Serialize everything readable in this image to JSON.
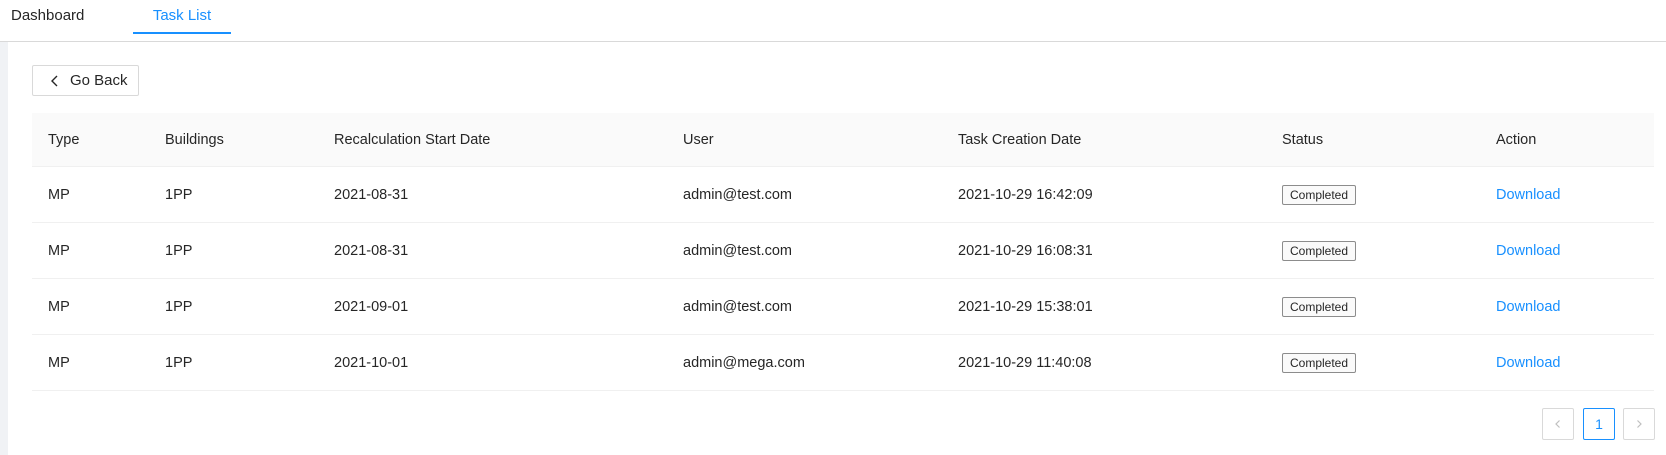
{
  "tabs": [
    {
      "label": "Dashboard",
      "active": false
    },
    {
      "label": "Task List",
      "active": true
    }
  ],
  "back_button": {
    "label": "Go Back"
  },
  "table": {
    "columns": [
      "Type",
      "Buildings",
      "Recalculation Start Date",
      "User",
      "Task Creation Date",
      "Status",
      "Action"
    ],
    "rows": [
      [
        "MP",
        "1PP",
        "2021-08-31",
        "admin@test.com",
        "2021-10-29 16:42:09",
        "Completed",
        "Download"
      ],
      [
        "MP",
        "1PP",
        "2021-08-31",
        "admin@test.com",
        "2021-10-29 16:08:31",
        "Completed",
        "Download"
      ],
      [
        "MP",
        "1PP",
        "2021-09-01",
        "admin@test.com",
        "2021-10-29 15:38:01",
        "Completed",
        "Download"
      ],
      [
        "MP",
        "1PP",
        "2021-10-01",
        "admin@mega.com",
        "2021-10-29 11:40:08",
        "Completed",
        "Download"
      ]
    ]
  },
  "pagination": {
    "current_page": "1"
  },
  "colors": {
    "accent": "#1890ff",
    "border": "#d9d9d9",
    "header_bg": "#fafafa"
  },
  "icons": {
    "back": "chevron-left-icon",
    "prev": "chevron-left-icon",
    "next": "chevron-right-icon"
  }
}
